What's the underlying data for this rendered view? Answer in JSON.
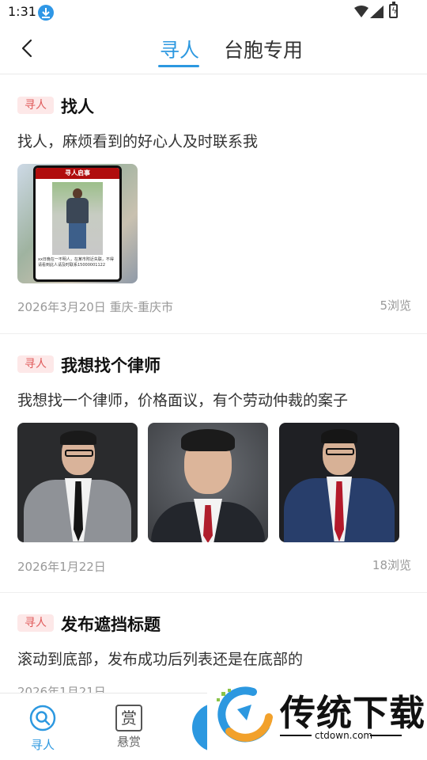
{
  "status_bar": {
    "time": "1:31"
  },
  "header": {
    "tabs": [
      {
        "label": "寻人",
        "active": true
      },
      {
        "label": "台胞专用",
        "active": false
      }
    ]
  },
  "posts": [
    {
      "tag": "寻人",
      "title": "找人",
      "body": "找人，麻烦看到的好心人及时联系我",
      "date": "2026年3月20日  重庆-重庆市",
      "views": "5浏览",
      "images": [
        {
          "poster_title": "寻人启事",
          "poster_text": "xx日晚在一不明人，在某市附近失联，不得请看到此人请及时联系15000001122"
        }
      ]
    },
    {
      "tag": "寻人",
      "title": "我想找个律师",
      "body": "我想找一个律师，价格面议，有个劳动仲裁的案子",
      "date": "2026年1月22日",
      "views": "18浏览",
      "images": [
        "lawyer-photo-1",
        "lawyer-photo-2",
        "lawyer-photo-3"
      ]
    },
    {
      "tag": "寻人",
      "title": "发布遮挡标题",
      "body": "滚动到底部，发布成功后列表还是在底部的",
      "date": "2026年1月21日"
    }
  ],
  "bottom_nav": {
    "items": [
      {
        "label": "寻人",
        "icon": "search-icon",
        "active": true
      },
      {
        "label": "悬赏",
        "icon_text": "赏",
        "active": false
      }
    ]
  },
  "watermark": {
    "text": "传统下载",
    "url": "ctdown.com"
  },
  "colors": {
    "accent": "#2c98e0",
    "tag_bg": "#fde8e8",
    "tag_text": "#e05a5a"
  }
}
